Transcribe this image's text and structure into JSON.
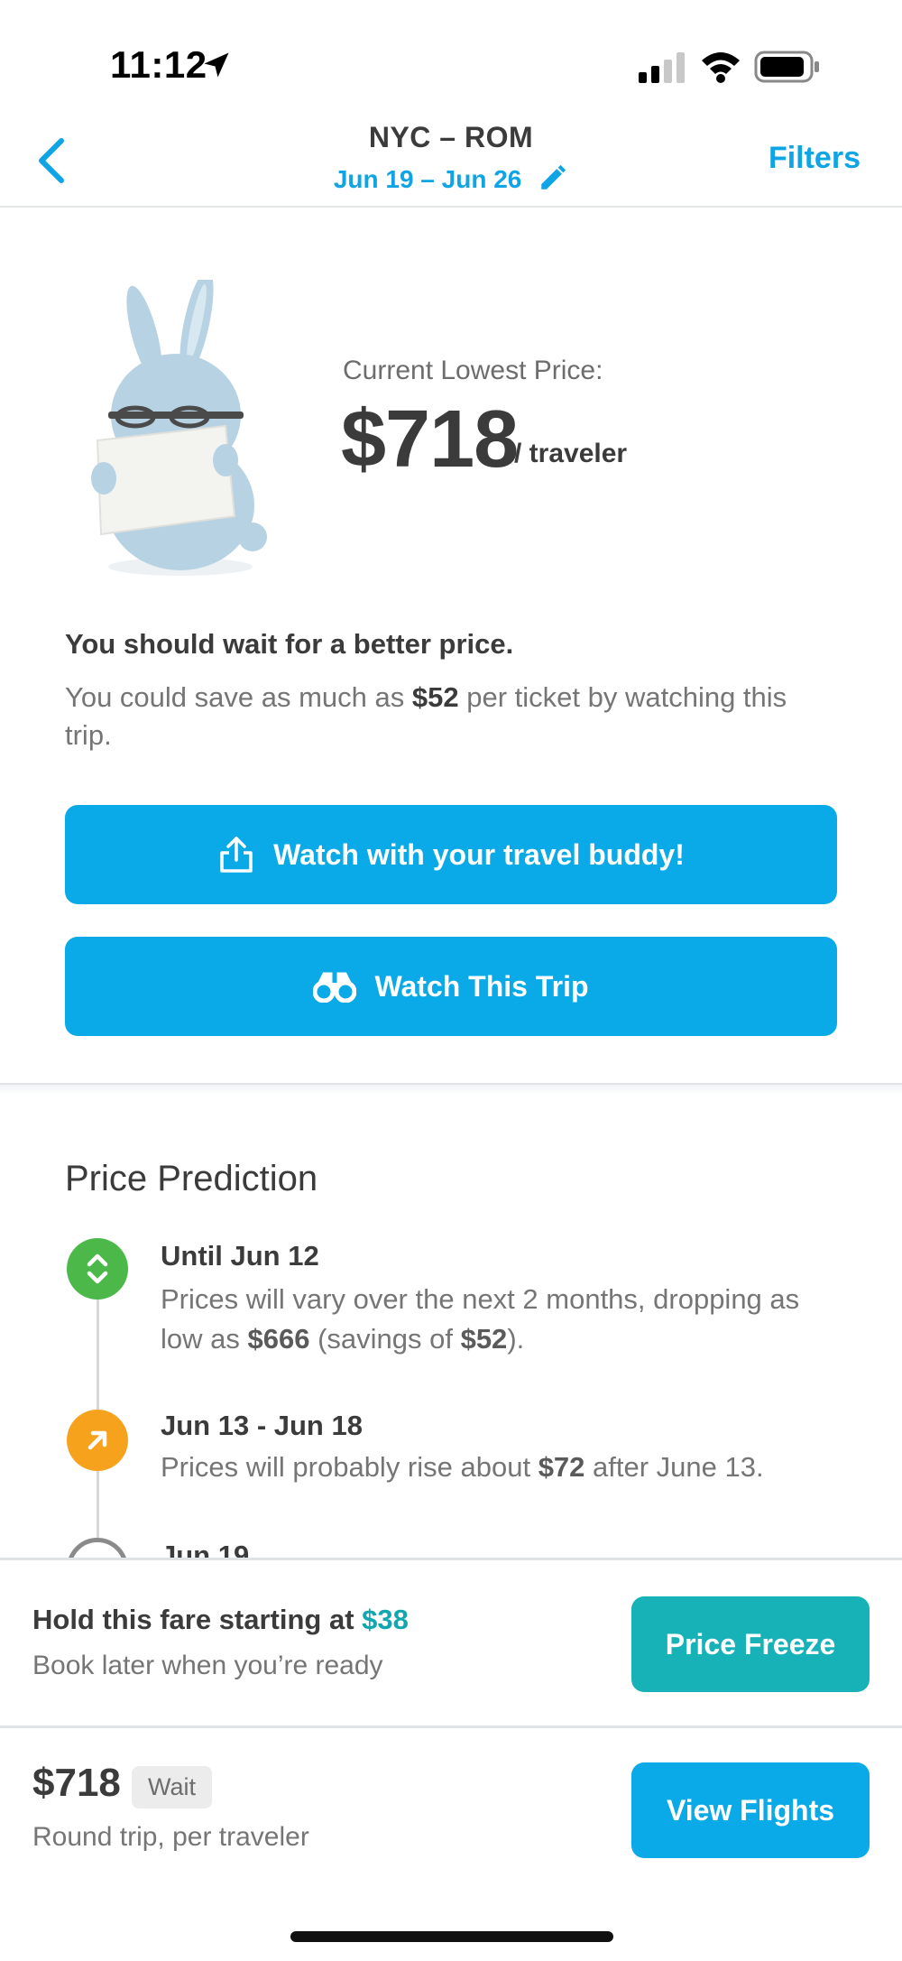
{
  "status_bar": {
    "time": "11:12"
  },
  "nav": {
    "title": "NYC – ROM",
    "dates": "Jun 19 – Jun 26",
    "filters_label": "Filters"
  },
  "price_card": {
    "label": "Current Lowest Price:",
    "price": "$718",
    "unit": "/ traveler"
  },
  "advice": {
    "title": "You should wait for a better price.",
    "body_prefix": "You could save as much as ",
    "body_amount": "$52",
    "body_suffix": " per ticket by watching this trip."
  },
  "buttons": {
    "buddy_label": "Watch with your travel buddy!",
    "watch_label": "Watch This Trip"
  },
  "prediction": {
    "title": "Price Prediction",
    "items": [
      {
        "head": "Until Jun 12",
        "text_a": "Prices will vary over the next 2 months, dropping as low as ",
        "amount_a": "$666",
        "text_b": " (savings of ",
        "amount_b": "$52",
        "text_c": ")."
      },
      {
        "head": "Jun 13 - Jun 18",
        "text_a": "Prices will probably rise about ",
        "amount_a": "$72",
        "text_b": " after June 13."
      },
      {
        "head": "Jun 19"
      }
    ]
  },
  "hold": {
    "title_prefix": "Hold this fare starting at ",
    "title_amount": "$38",
    "subtitle": "Book later when you’re ready",
    "button_label": "Price Freeze"
  },
  "bottom": {
    "price": "$718",
    "badge": "Wait",
    "subtitle": "Round trip, per traveler",
    "button_label": "View Flights"
  },
  "colors": {
    "accent_blue": "#0aa9e8",
    "teal": "#16b2b8",
    "green": "#4cb84a",
    "orange": "#f7a21c"
  }
}
